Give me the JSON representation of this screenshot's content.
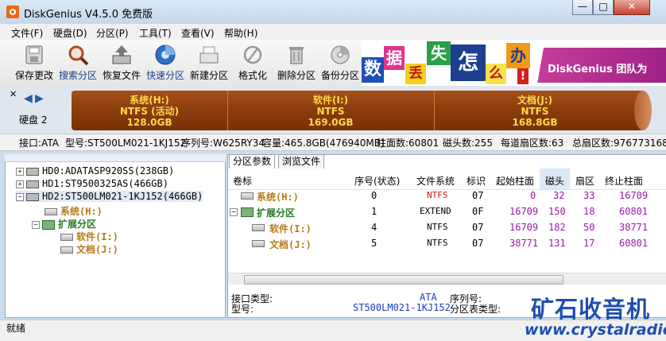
{
  "window": {
    "title": "DiskGenius V4.5.0 免费版",
    "buttons": {
      "minimize": "—",
      "maximize": "□",
      "close": "✕"
    }
  },
  "menu": [
    "文件(F)",
    "硬盘(D)",
    "分区(P)",
    "工具(T)",
    "查看(V)",
    "帮助(H)"
  ],
  "toolbar": [
    {
      "label": "保存更改",
      "icon": "save-icon"
    },
    {
      "label": "搜索分区",
      "icon": "magnifier-icon"
    },
    {
      "label": "恢复文件",
      "icon": "recover-icon"
    },
    {
      "label": "快速分区",
      "icon": "quick-partition-icon"
    },
    {
      "label": "新建分区",
      "icon": "new-partition-icon"
    },
    {
      "label": "格式化",
      "icon": "format-icon"
    },
    {
      "label": "删除分区",
      "icon": "trash-icon"
    },
    {
      "label": "备份分区",
      "icon": "backup-disk-icon"
    }
  ],
  "banner": {
    "chars": [
      "数",
      "据",
      "丢",
      "失",
      "怎",
      "么",
      "办",
      "!"
    ],
    "text": "DiskGenius 团队为"
  },
  "disk": {
    "label": "硬盘 2",
    "partitions": [
      {
        "name": "系统(H:)",
        "fs": "NTFS (活动)",
        "size": "128.0GB"
      },
      {
        "name": "软件(I:)",
        "fs": "NTFS",
        "size": "169.0GB"
      },
      {
        "name": "文档(J:)",
        "fs": "NTFS",
        "size": "168.8GB"
      }
    ]
  },
  "info": {
    "interface": "接口:ATA",
    "model": "型号:ST500LM021-1KJ152",
    "serial": "序列号:W625RY34",
    "capacity": "容量:465.8GB(476940MB)",
    "cylinders": "柱面数:60801",
    "heads": "磁头数:255",
    "sectors_per_track": "每道扇区数:63",
    "total_sectors": "总扇区数:976773168"
  },
  "tree": {
    "disks": [
      "HD0:ADATASP920SS(238GB)",
      "HD1:ST9500325AS(466GB)",
      "HD2:ST500LM021-1KJ152(466GB)"
    ],
    "partitions": [
      "系统(H:)",
      "扩展分区",
      "软件(I:)",
      "文档(J:)"
    ]
  },
  "tabs": [
    "分区参数",
    "浏览文件"
  ],
  "table": {
    "headers": [
      "卷标",
      "序号(状态)",
      "文件系统",
      "标识",
      "起始柱面",
      "磁头",
      "扇区",
      "终止柱面"
    ],
    "rows": [
      {
        "label": "系统(H:)",
        "index": "0",
        "fs": "NTFS",
        "id": "07",
        "start_cyl": "0",
        "head": "32",
        "sector": "33",
        "end_cyl": "16709"
      },
      {
        "label": "扩展分区",
        "index": "1",
        "fs": "EXTEND",
        "id": "0F",
        "start_cyl": "16709",
        "head": "150",
        "sector": "18",
        "end_cyl": "60801"
      },
      {
        "label": "软件(I:)",
        "index": "4",
        "fs": "NTFS",
        "id": "07",
        "start_cyl": "16709",
        "head": "182",
        "sector": "50",
        "end_cyl": "38771"
      },
      {
        "label": "文档(J:)",
        "index": "5",
        "fs": "NTFS",
        "id": "07",
        "start_cyl": "38771",
        "head": "131",
        "sector": "17",
        "end_cyl": "60801"
      }
    ]
  },
  "details": {
    "interface_label": "接口类型:",
    "interface_value": "ATA",
    "model_label": "型号:",
    "model_value": "ST500LM021-1KJ152",
    "serial_label": "序列号:",
    "table_type_label": "分区表类型:"
  },
  "status": "就绪",
  "watermark": {
    "cn": "矿石收音机",
    "url": "www.crystalradio.cn"
  },
  "colors": {
    "partition_bar": "#8a3c0b",
    "partition_text": "#ffd84a",
    "selected": "#e1e9f4"
  }
}
